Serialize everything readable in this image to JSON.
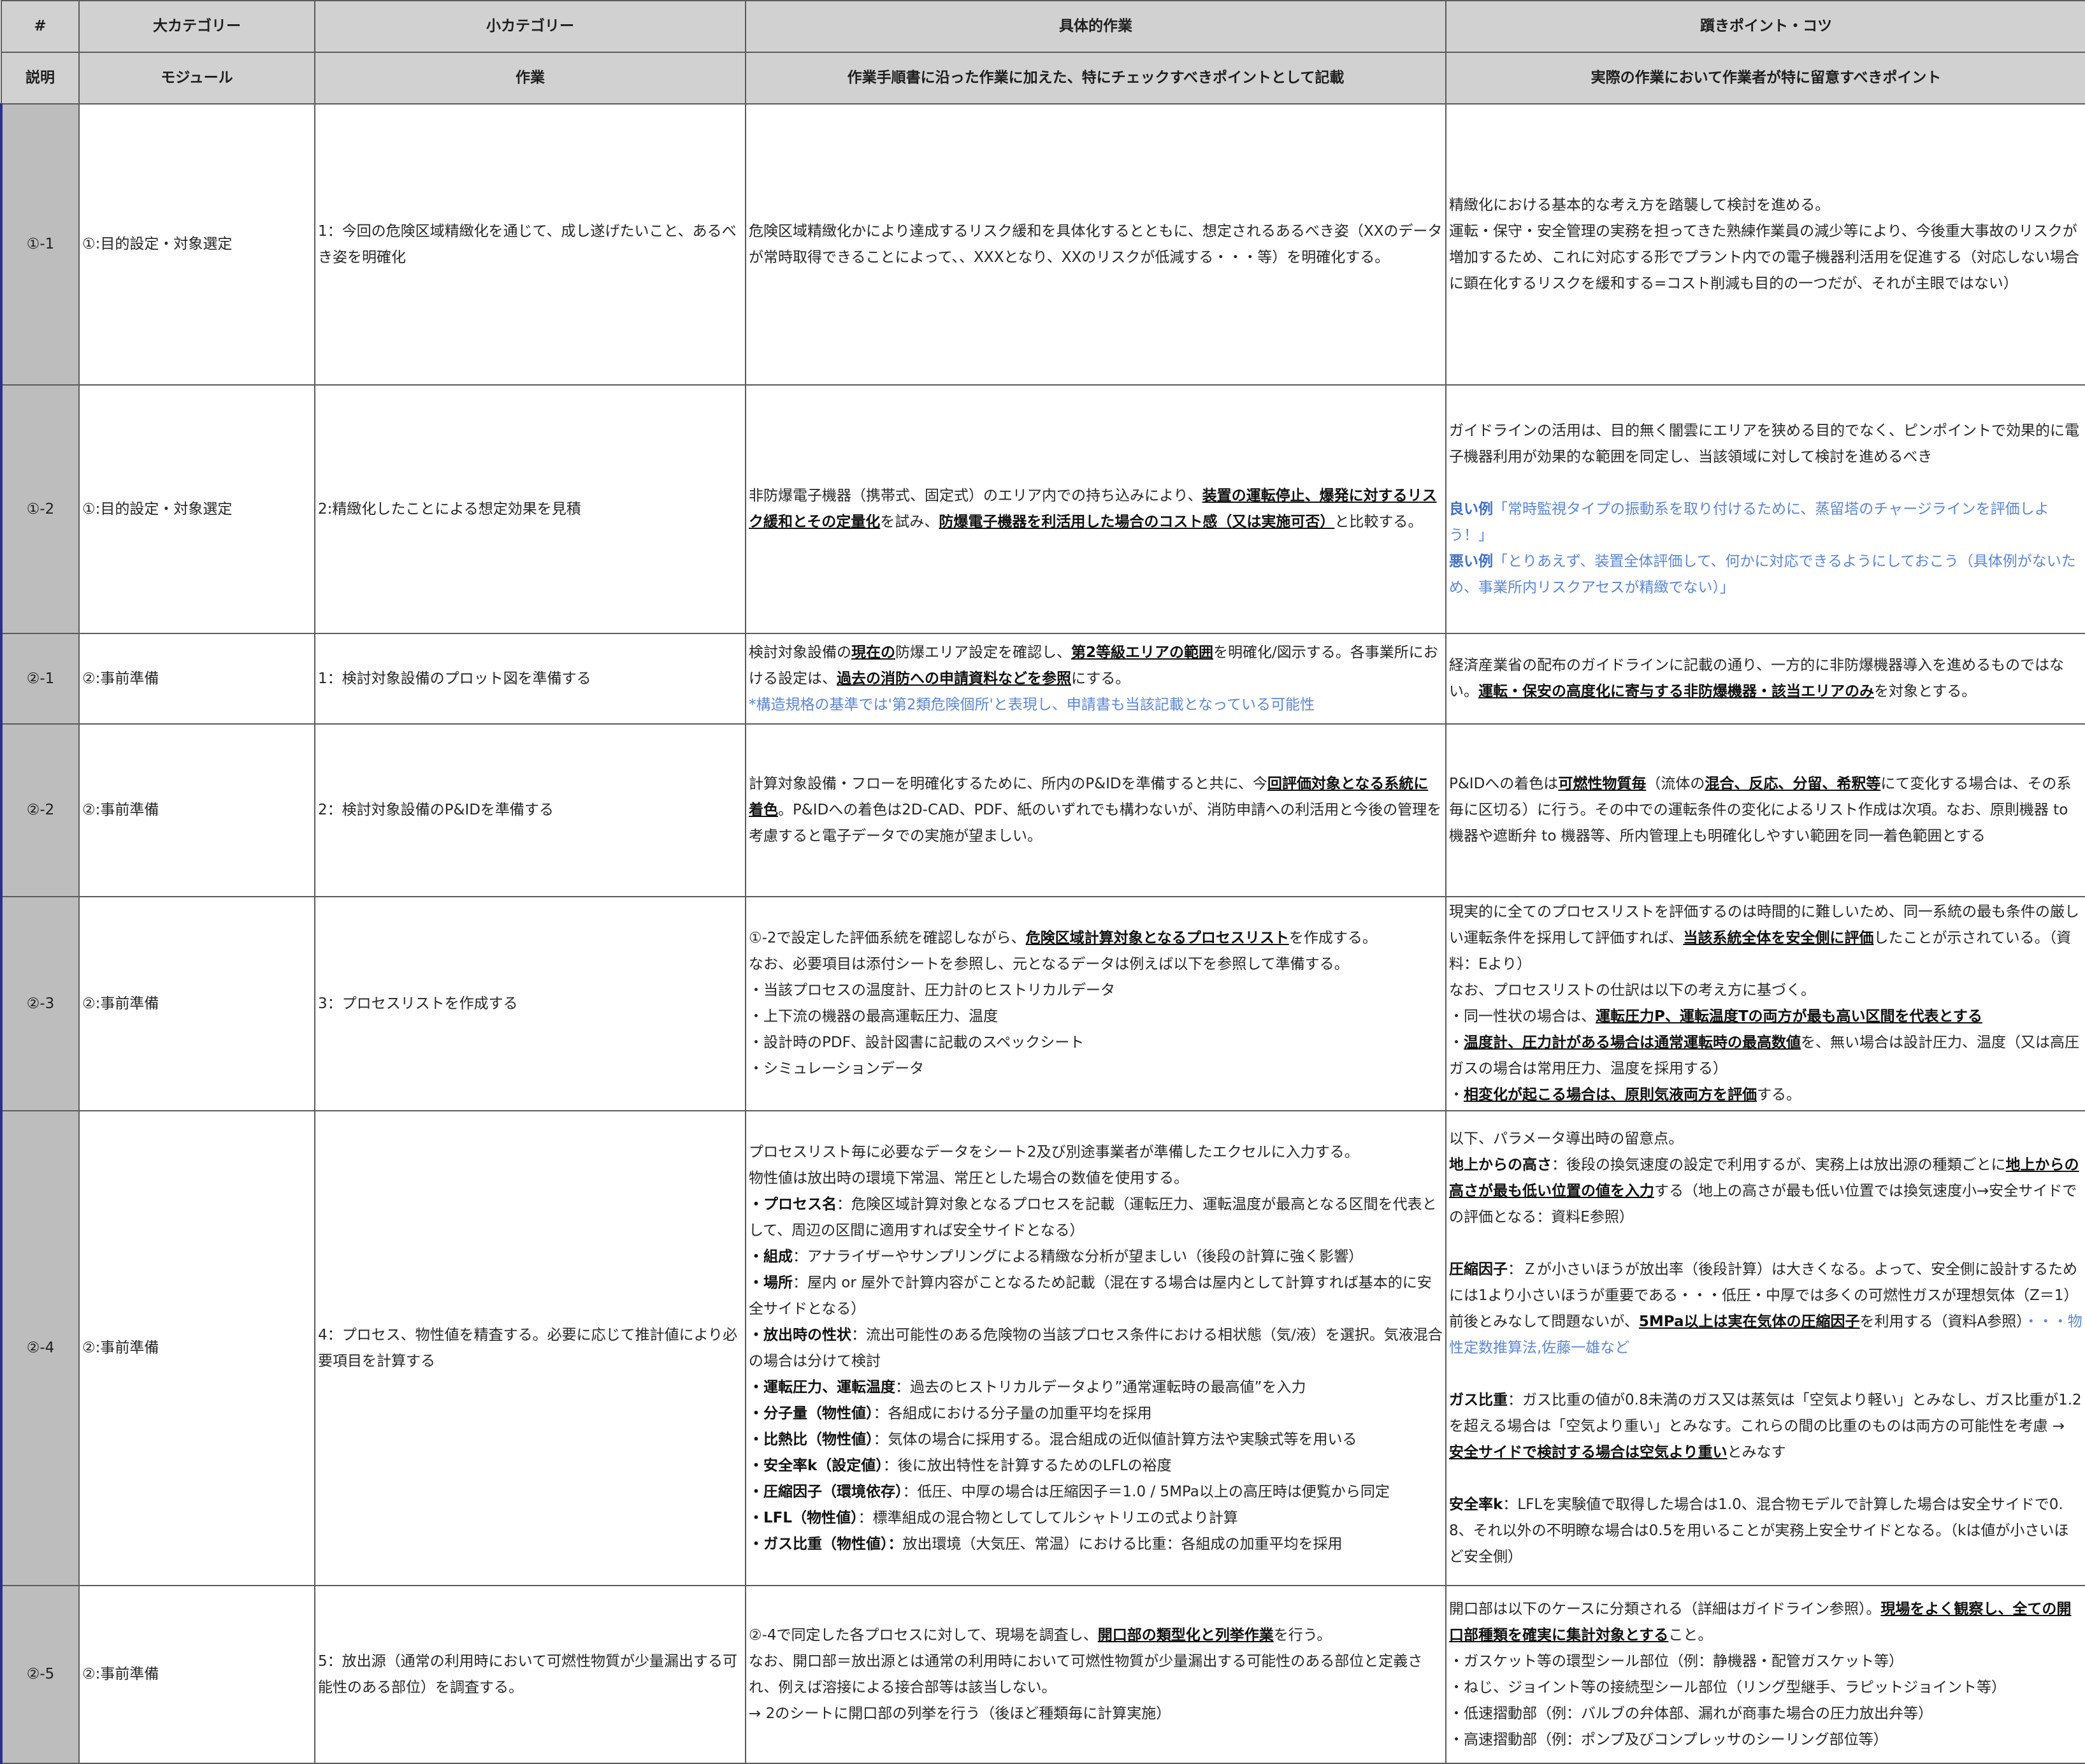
{
  "header": {
    "col_num": "#",
    "col_major": "大カテゴリー",
    "col_minor": "小カテゴリー",
    "col_work": "具体的作業",
    "col_tips": "躓きポイント・コツ"
  },
  "explain": {
    "num": "説明",
    "major": "モジュール",
    "minor": "作業",
    "work": "作業手順書に沿った作業に加えた、特にチェックすべきポイントとして記載",
    "tips": "実際の作業において作業者が特に留意すべきポイント"
  },
  "rows": [
    {
      "num": "①-1",
      "major": "①:目的設定・対象選定",
      "minor": "1：今回の危険区域精緻化を通じて、成し遂げたいこと、あるべき姿を明確化",
      "work": [
        "危険区域精緻化かにより達成するリスク緩和を具体化するとともに、想定されるあるべき姿（XXのデータが常時取得できることによって、、XXXとなり、XXのリスクが低減する・・・等）を明確化する。"
      ],
      "tips": [
        "精緻化における基本的な考え方を踏襲して検討を進める。",
        "運転・保守・安全管理の実務を担ってきた熟練作業員の減少等により、今後重大事故のリスクが増加するため、これに対応する形でプラント内での電子機器利活用を促進する（対応しない場合に顕在化するリスクを緩和する=コスト削減も目的の一つだが、それが主眼ではない）"
      ]
    },
    {
      "num": "①-2",
      "major": "①:目的設定・対象選定",
      "minor": "2:精緻化したことによる想定効果を見積",
      "work": {
        "t1": "非防爆電子機器（携帯式、固定式）のエリア内での持ち込みにより、",
        "b1": "装置の運転停止、爆発に対するリスク緩和とその定量化",
        "t2": "を試み、",
        "b2": "防爆電子機器を利活用した場合のコスト感（又は実施可否）",
        "t3": "と比較する。"
      },
      "tips": {
        "p1": "ガイドラインの活用は、目的無く闇雲にエリアを狭める目的でなく、ピンポイントで効果的に電子機器利用が効果的な範囲を同定し、当該領域に対して検討を進めるべき",
        "good_label": "良い例",
        "good_text": "「常時監視タイプの振動系を取り付けるために、蒸留塔のチャージラインを評価しよう！」",
        "bad_label": "悪い例",
        "bad_text": "「とりあえず、装置全体評価して、何かに対応できるようにしておこう（具体例がないため、事業所内リスクアセスが精緻でない）」"
      }
    },
    {
      "num": "②-1",
      "major": "②:事前準備",
      "minor": "1：検討対象設備のプロット図を準備する",
      "work": {
        "t1": "検討対象設備の",
        "b1": "現在の",
        "t2": "防爆エリア設定を確認し、",
        "b2": "第2等級エリアの範囲",
        "t3": "を明確化/図示する。各事業所における設定は、",
        "b3": "過去の消防への申請資料などを参照",
        "t4": "にする。",
        "note": "*構造規格の基準では'第2類危険個所'と表現し、申請書も当該記載となっている可能性"
      },
      "tips": {
        "t1": "経済産業省の配布のガイドラインに記載の通り、一方的に非防爆機器導入を進めるものではない。",
        "b1": "運転・保安の高度化に寄与する非防爆機器・該当エリアのみ",
        "t2": "を対象とする。"
      }
    },
    {
      "num": "②-2",
      "major": "②:事前準備",
      "minor": "2：検討対象設備のP&IDを準備する",
      "work": {
        "t1": "計算対象設備・フローを明確化するために、所内のP&IDを準備すると共に、今",
        "b1": "回評価対象となる系統に着色",
        "t2": "。P&IDへの着色は2D-CAD、PDF、紙のいずれでも構わないが、消防申請への利活用と今後の管理を考慮すると電子データでの実施が望ましい。"
      },
      "tips": {
        "t1": "P&IDへの着色は",
        "b1": "可燃性物質毎",
        "t2": "（流体の",
        "b2": "混合、反応、分留、希釈等",
        "t3": "にて変化する場合は、その系毎に区切る）に行う。その中での運転条件の変化によるリスト作成は次項。なお、原則機器 to 機器や遮断弁 to 機器等、所内管理上も明確化しやすい範囲を同一着色範囲とする"
      }
    },
    {
      "num": "②-3",
      "major": "②:事前準備",
      "minor": "3：プロセスリストを作成する",
      "work": {
        "t1": "①-2で設定した評価系統を確認しながら、",
        "b1": "危険区域計算対象となるプロセスリスト",
        "t2": "を作成する。",
        "lines": [
          "なお、必要項目は添付シートを参照し、元となるデータは例えば以下を参照して準備する。",
          "・当該プロセスの温度計、圧力計のヒストリカルデータ",
          "・上下流の機器の最高運転圧力、温度",
          "・設計時のPDF、設計図書に記載のスペックシート",
          "・シミュレーションデータ"
        ]
      },
      "tips": {
        "t1": "現実的に全てのプロセスリストを評価するのは時間的に難しいため、同一系統の最も条件の厳しい運転条件を採用して評価すれば、",
        "b1": "当該系統全体を安全側に評価",
        "t2": "したことが示されている。（資料：Eより）",
        "l2": "なお、プロセスリストの仕訳は以下の考え方に基づく。",
        "l3a": "・同一性状の場合は、",
        "l3b": "運転圧力P、運転温度Tの両方が最も高い区間を代表とする",
        "l4a": "・",
        "l4b": "温度計、圧力計がある場合は通常運転時の最高数値",
        "l4c": "を、無い場合は設計圧力、温度（又は高圧ガスの場合は常用圧力、温度を採用する）",
        "l5a": "・",
        "l5b": "相変化が起こる場合は、原則気液両方を評価",
        "l5c": "する。"
      }
    },
    {
      "num": "②-4",
      "major": "②:事前準備",
      "minor": "4：プロセス、物性値を精査する。必要に応じて推計値により必要項目を計算する",
      "work": {
        "l1": "プロセスリスト毎に必要なデータをシート2及び別途事業者が準備したエクセルに入力する。",
        "l2": "物性値は放出時の環境下常温、常圧とした場合の数値を使用する。",
        "items": [
          {
            "label": "・プロセス名",
            "text": "：危険区域計算対象となるプロセスを記載（運転圧力、運転温度が最高となる区間を代表として、周辺の区間に適用すれば安全サイドとなる）"
          },
          {
            "label": "・組成",
            "text": "：アナライザーやサンプリングによる精緻な分析が望ましい（後段の計算に強く影響）"
          },
          {
            "label": "・場所",
            "text": "：屋内 or 屋外で計算内容がことなるため記載（混在する場合は屋内として計算すれば基本的に安全サイドとなる）"
          },
          {
            "label": "・放出時の性状",
            "text": "：流出可能性のある危険物の当該プロセス条件における相状態（気/液）を選択。気液混合の場合は分けて検討"
          },
          {
            "label": "・運転圧力、運転温度",
            "text": "：過去のヒストリカルデータより”通常運転時の最高値”を入力"
          },
          {
            "label": "・分子量（物性値）",
            "text": "：各組成における分子量の加重平均を採用"
          },
          {
            "label": "・比熱比（物性値）",
            "text": "：気体の場合に採用する。混合組成の近似値計算方法や実験式等を用いる"
          },
          {
            "label": "・安全率k（設定値）",
            "text": "：後に放出特性を計算するためのLFLの裕度"
          },
          {
            "label": "・圧縮因子（環境依存）",
            "text": "：低圧、中厚の場合は圧縮因子＝1.0 / 5MPa以上の高圧時は便覧から同定"
          },
          {
            "label": "・LFL（物性値）",
            "text": "：標準組成の混合物としてしてルシャトリエの式より計算"
          },
          {
            "label": "・ガス比重（物性値）：",
            "text": "放出環境（大気圧、常温）における比重：各組成の加重平均を採用"
          }
        ]
      },
      "tips": {
        "l1": "以下、パラメータ導出時の留意点。",
        "h1_label": "地上からの高さ",
        "h1_t1": "：後段の換気速度の設定で利用するが、実務上は放出源の種類ごとに",
        "h1_b1": "地上からの高さが最も低い位置の値を入力",
        "h1_t2": "する（地上の高さが最も低い位置では換気速度小→安全サイドでの評価となる：資料E参照）",
        "h2_label": "圧縮因子",
        "h2_t1": "：Ｚが小さいほうが放出率（後段計算）は大きくなる。よって、安全側に設計するためには1より小さいほうが重要である・・・低圧・中厚では多くの可燃性ガスが理想気体（Z＝1）前後とみなして問題ないが、",
        "h2_b1": "5MPa以上は実在気体の圧縮因子",
        "h2_t2": "を利用する（資料A参照）",
        "h2_blue": "・・・物性定数推算法,佐藤一雄など",
        "h3_label": "ガス比重",
        "h3_t1": "：ガス比重の値が0.8未満のガス又は蒸気は「空気より軽い」とみなし、ガス比重が1.2を超える場合は「空気より重い」とみなす。これらの間の比重のものは両方の可能性を考慮 →　",
        "h3_b1": "安全サイドで検討する場合は空気より重い",
        "h3_t2": "とみなす",
        "h4_label": "安全率k",
        "h4_t1": "：LFLを実験値で取得した場合は1.0、混合物モデルで計算した場合は安全サイドで0.8、それ以外の不明瞭な場合は0.5を用いることが実務上安全サイドとなる。（kは値が小さいほど安全側）"
      }
    },
    {
      "num": "②-5",
      "major": "②:事前準備",
      "minor": "5：放出源（通常の利用時において可燃性物質が少量漏出する可能性のある部位）を調査する。",
      "work": {
        "t1": "②-4で同定した各プロセスに対して、現場を調査し、",
        "b1": "開口部の類型化と列挙作業",
        "t2": "を行う。",
        "l2": "なお、開口部＝放出源とは通常の利用時において可燃性物質が少量漏出する可能性のある部位と定義され、例えば溶接による接合部等は該当しない。",
        "l3": "→ 2のシートに開口部の列挙を行う（後ほど種類毎に計算実施）"
      },
      "tips": {
        "t1": "開口部は以下のケースに分類される（詳細はガイドライン参照）。",
        "b1": "現場をよく観察し、全ての開口部種類を確実に集計対象とする",
        "t2": "こと。",
        "lines": [
          "・ガスケット等の環型シール部位（例：静機器・配管ガスケット等）",
          "・ねじ、ジョイント等の接続型シール部位（リング型継手、ラピットジョイント等）",
          "・低速摺動部（例：バルブの弁体部、漏れが商事た場合の圧力放出弁等）",
          "・高速摺動部（例：ポンプ及びコンプレッサのシーリング部位等）"
        ]
      }
    }
  ]
}
